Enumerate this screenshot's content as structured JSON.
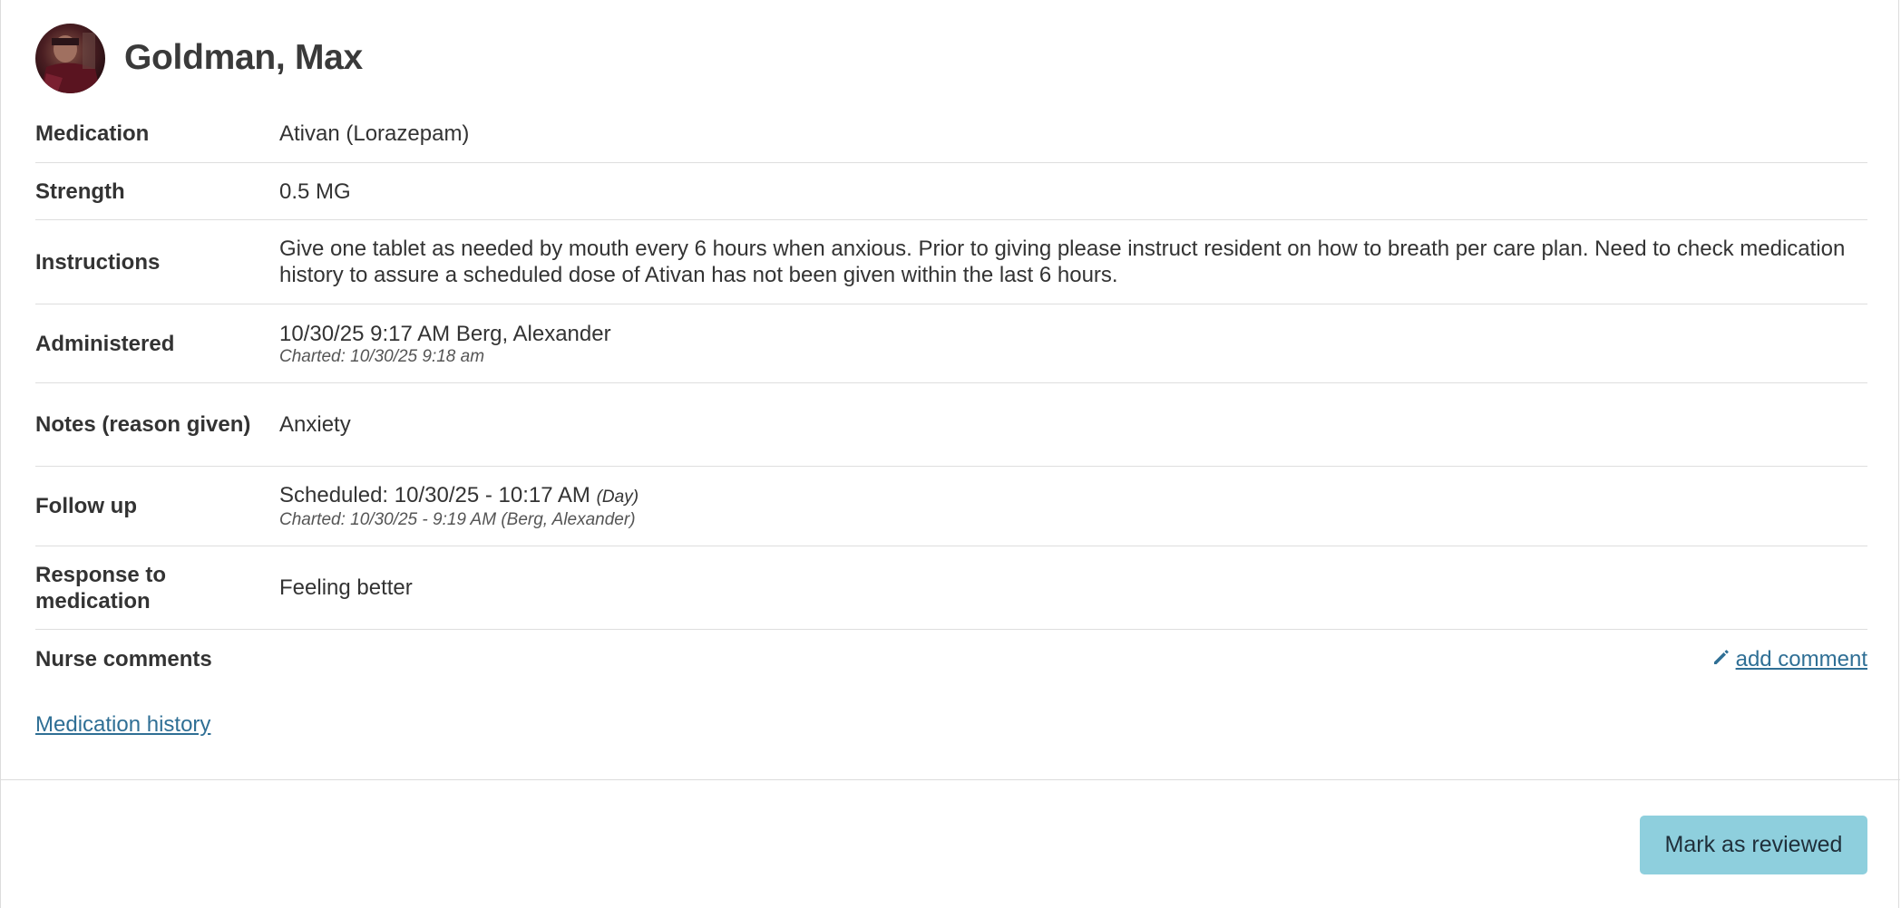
{
  "patient": {
    "name": "Goldman, Max"
  },
  "details": {
    "medication": {
      "label": "Medication",
      "value": "Ativan (Lorazepam)"
    },
    "strength": {
      "label": "Strength",
      "value": "0.5 MG"
    },
    "instructions": {
      "label": "Instructions",
      "value": "Give one tablet as needed by mouth every 6 hours when anxious. Prior to giving please instruct resident on how to breath per care plan. Need to check medication history to assure a scheduled dose of Ativan has not been given within the last 6 hours."
    },
    "administered": {
      "label": "Administered",
      "value": "10/30/25 9:17 AM Berg, Alexander",
      "charted": "Charted: 10/30/25 9:18 am"
    },
    "notes": {
      "label": "Notes (reason given)",
      "value": "Anxiety"
    },
    "follow_up": {
      "label": "Follow up",
      "value": "Scheduled: 10/30/25 - 10:17 AM",
      "shift": "(Day)",
      "charted": "Charted: 10/30/25 - 9:19 AM (Berg, Alexander)"
    },
    "response": {
      "label": "Response to medication",
      "value": "Feeling better"
    },
    "nurse_comments": {
      "label": "Nurse comments",
      "action": "add comment"
    }
  },
  "links": {
    "medication_history": "Medication history"
  },
  "footer": {
    "mark_reviewed": "Mark as reviewed"
  },
  "colors": {
    "link": "#2f6f95",
    "button_bg": "#8ecfdd"
  },
  "icons": {
    "avatar": "patient-avatar-photo",
    "comment": "pencil-icon"
  }
}
